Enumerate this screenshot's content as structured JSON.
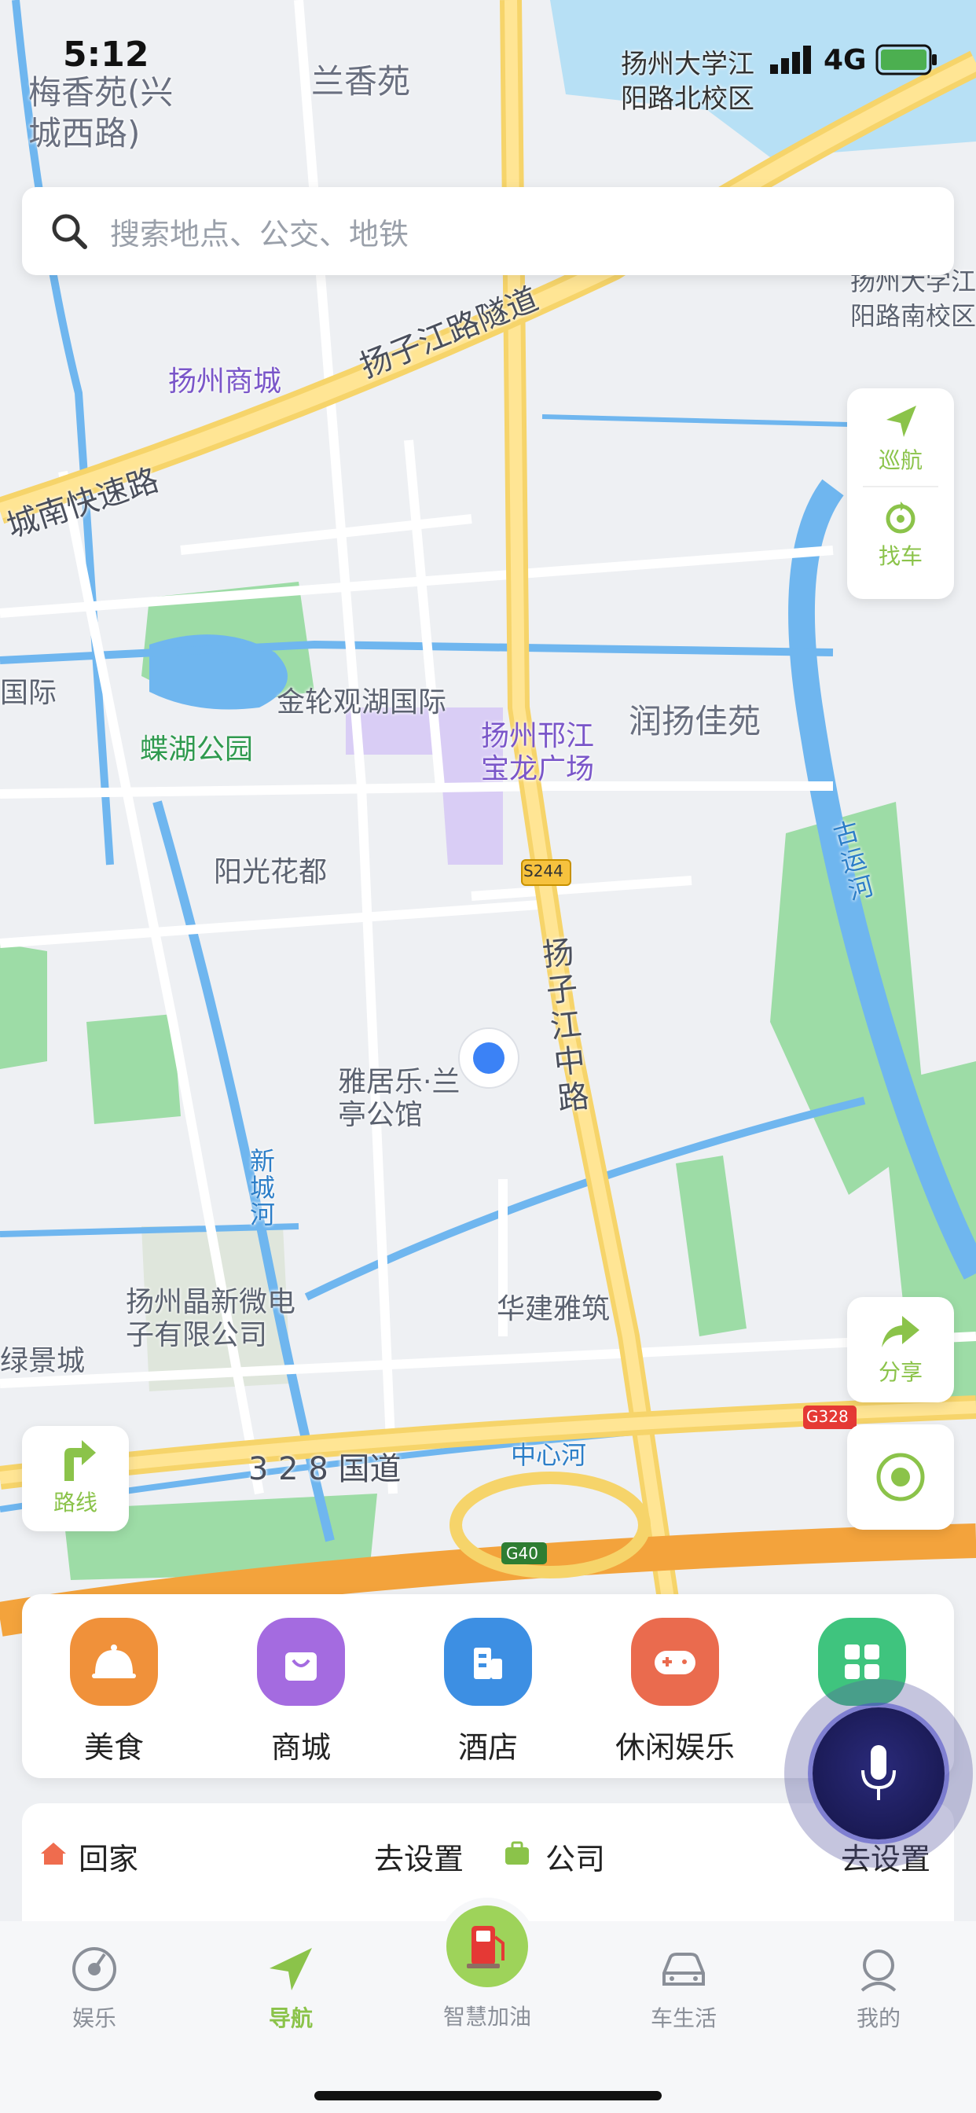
{
  "status_bar": {
    "time": "5:12",
    "network": "4G"
  },
  "search": {
    "placeholder": "搜索地点、公交、地铁"
  },
  "map": {
    "labels": {
      "top_school": "扬州大学江阳路北校区",
      "top_left_area": "梅香苑(兴城西路)",
      "top_area": "兰香苑",
      "right_school": "扬州大学江阳路南校区",
      "mall": "扬州商城",
      "tunnel": "扬子江路隧道",
      "expressway": "城南快速路",
      "jinlun": "金轮观湖国际",
      "butterfly_park": "蝶湖公园",
      "baolong": "扬州邗江宝龙广场",
      "runyang": "润扬佳苑",
      "yangguang": "阳光花都",
      "canal": "古运河",
      "road_s244": "S244",
      "yangzijiang_road": "扬子江中路",
      "yaju": "雅居乐·兰亭公馆",
      "xincheng_river": "新城河",
      "huajian": "华建雅筑",
      "jingxin": "扬州晶新微电子有限公司",
      "lvjing": "绿景城",
      "guodao": "3 2 8 国道",
      "zhongxin_river": "中心河",
      "g328": "G328",
      "g40": "G40",
      "left_edge": "国际"
    }
  },
  "side_buttons": {
    "cruise": "巡航",
    "find_car": "找车",
    "share": "分享",
    "route": "路线"
  },
  "quick_menu": [
    {
      "label": "美食",
      "icon": "food-icon",
      "color": "#f0913a"
    },
    {
      "label": "商城",
      "icon": "shopping-bag-icon",
      "color": "#a46be0"
    },
    {
      "label": "酒店",
      "icon": "hotel-icon",
      "color": "#3d8fe3"
    },
    {
      "label": "休闲娱乐",
      "icon": "gamepad-icon",
      "color": "#ea6b4e"
    },
    {
      "label": "",
      "icon": "grid-icon",
      "color": "#3fc47e"
    }
  ],
  "shortcuts": {
    "home_label": "回家",
    "home_action": "去设置",
    "work_label": "公司",
    "work_action": "去设置"
  },
  "tabs": [
    {
      "label": "娱乐",
      "icon": "music-icon"
    },
    {
      "label": "导航",
      "icon": "navigation-icon"
    },
    {
      "label": "智慧加油",
      "icon": "fuel-pump-icon"
    },
    {
      "label": "车生活",
      "icon": "car-icon"
    },
    {
      "label": "我的",
      "icon": "profile-icon"
    }
  ],
  "colors": {
    "accent": "#8bc34a",
    "map_bg": "#eef0f3",
    "water": "#6fb6ef",
    "park": "#9ddca6",
    "highway": "#f3a33c"
  }
}
